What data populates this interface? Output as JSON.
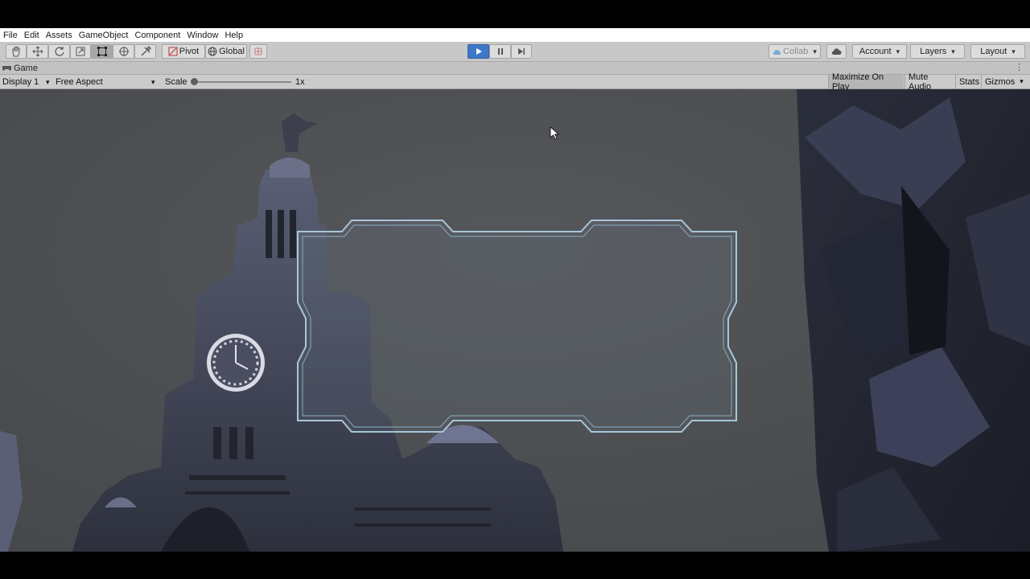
{
  "menu": {
    "items": [
      "File",
      "Edit",
      "Assets",
      "GameObject",
      "Component",
      "Window",
      "Help"
    ]
  },
  "toolbar": {
    "tools": [
      "hand-tool",
      "move-tool",
      "rotate-tool",
      "scale-tool",
      "rect-tool",
      "transform-tool",
      "custom-tool"
    ],
    "pivot_label": "Pivot",
    "global_label": "Global",
    "collab_label": "Collab",
    "account_label": "Account",
    "layers_label": "Layers",
    "layout_label": "Layout"
  },
  "tab": {
    "title": "Game"
  },
  "game_toolbar": {
    "display": "Display 1",
    "aspect": "Free Aspect",
    "scale_label": "Scale",
    "scale_value": "1x",
    "scale_fraction": 0.0,
    "maximize_label": "Maximize On Play",
    "mute_label": "Mute Audio",
    "stats_label": "Stats",
    "gizmos_label": "Gizmos"
  },
  "colors": {
    "play_active": "#3d77c7",
    "frame_stroke": "#a8c6d8",
    "sky": "#4a4c50",
    "building": "#3a3d4a"
  }
}
